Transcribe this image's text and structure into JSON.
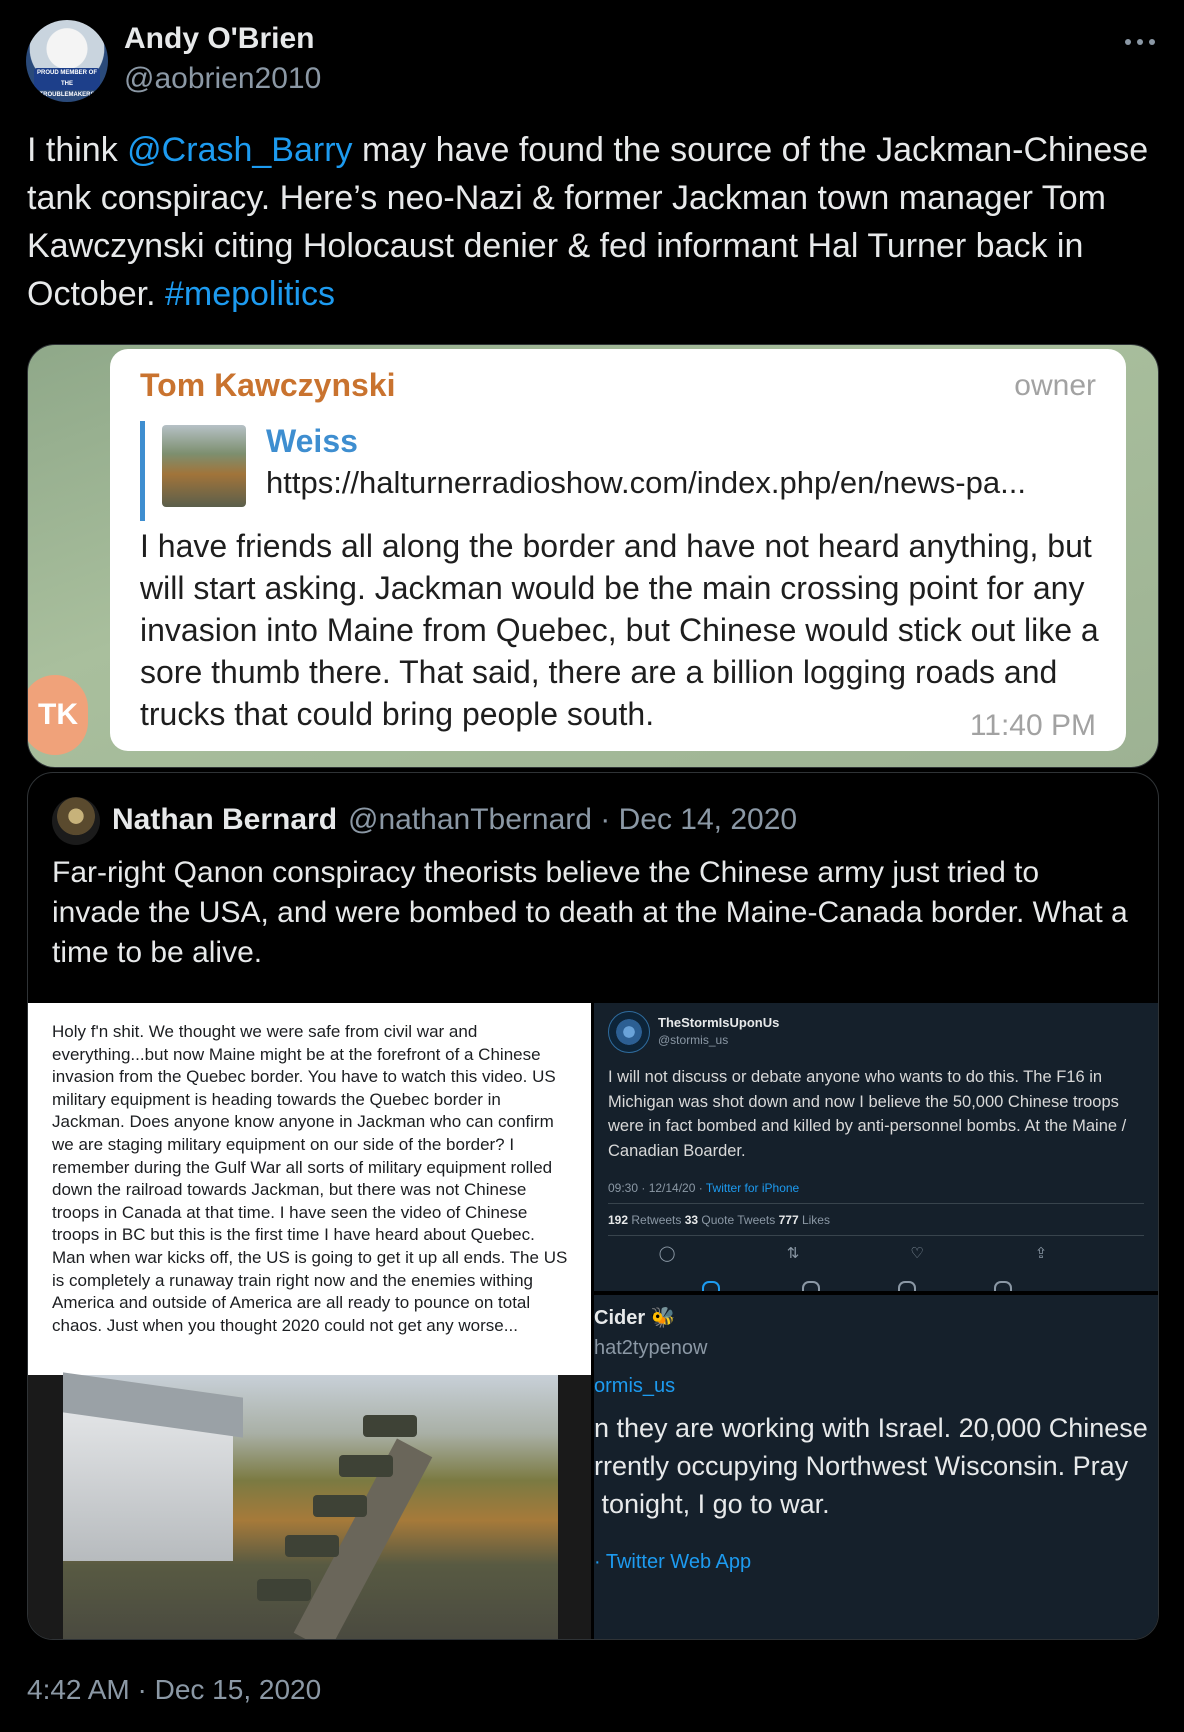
{
  "author": {
    "display_name": "Andy O'Brien",
    "handle": "@aobrien2010",
    "avatar_badge_text": "PROUD MEMBER OF THE TROUBLEMAKERS UNION"
  },
  "tweet": {
    "text_pre": "I think ",
    "mention": "@Crash_Barry",
    "text_mid": " may have found the source of the Jackman-Chinese tank conspiracy. Here’s neo-Nazi & former Jackman town manager Tom Kawczynski citing Holocaust denier & fed informant Hal Turner back in October. ",
    "hashtag": "#mepolitics",
    "timestamp": "4:42 AM · Dec 15, 2020"
  },
  "telegram": {
    "sender": "Tom Kawczynski",
    "role": "owner",
    "reply_name": "Weiss",
    "reply_url": "https://halturnerradioshow.com/index.php/en/news-pa...",
    "message": "I have friends all along the border and have not heard anything, but will start asking. Jackman would be the main crossing point for any invasion into Maine from Quebec, but Chinese would stick out like a sore thumb there.  That said, there are a billion logging roads and trucks that could bring people south.",
    "time": "11:40 PM",
    "avatar_initials": "TK"
  },
  "quote": {
    "name": "Nathan Bernard",
    "meta": "@nathanTbernard · Dec 14, 2020",
    "text": "Far-right Qanon conspiracy theorists believe the Chinese army just tried to invade the USA, and were bombed to death at the Maine-Canada border. What a time to be alive."
  },
  "fb_post": {
    "text": "Holy  f'n shit. We thought we were safe from civil war and everything...but  now Maine might be at the forefront of a Chinese invasion from the  Quebec border. You have to watch this video. US military equipment is  heading towards the Quebec border in Jackman. Does anyone know anyone in Jackman who can confirm we are staging military equipment on our side  of the border? I remember during the Gulf War all sorts of military  equipment rolled down the railroad towards Jackman, but there was not  Chinese troops in Canada at that time. I have seen the video of Chinese  troops in BC but this is the first time I have heard about Quebec. Man  when war kicks off, the US is going to get it up all ends. The US is  completely a runaway train right now and the enemies withing America and  outside of America are all ready to pounce on total chaos. Just when  you thought 2020 could not get any worse..."
  },
  "tw_card": {
    "name": "TheStormIsUponUs",
    "handle": "@stormis_us",
    "body": "I will not discuss or debate anyone who wants to do this. The F16 in Michigan was shot down and now I believe the 50,000 Chinese troops were in fact bombed and killed by anti-personnel bombs. At the Maine / Canadian Boarder.",
    "ts": "09:30 · 12/14/20 · ",
    "source": "Twitter for iPhone",
    "retweets": "192",
    "retweets_label": " Retweets ",
    "quotes": "33",
    "quotes_label": " Quote Tweets ",
    "likes": "777",
    "likes_label": " Likes"
  },
  "tw_card2": {
    "name": "Cider 🐝",
    "handle": "hat2typenow",
    "reply": "ormis_us",
    "body": "n they are working with Israel. 20,000 Chinese\nrrently occupying Northwest Wisconsin. Pray\n tonight, I go to war.",
    "source": "· Twitter Web App"
  }
}
